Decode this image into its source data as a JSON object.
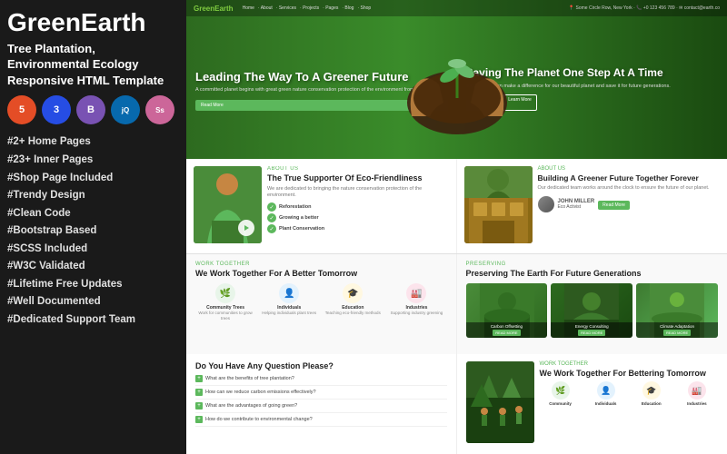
{
  "left": {
    "title": "GreenEarth",
    "subtitle": "Tree Plantation, Environmental Ecology Responsive HTML Template",
    "tech_icons": [
      {
        "label": "HTML5",
        "class": "tech-html",
        "text": "5"
      },
      {
        "label": "CSS3",
        "class": "tech-css",
        "text": "3"
      },
      {
        "label": "Bootstrap",
        "class": "tech-bs",
        "text": "B"
      },
      {
        "label": "jQuery",
        "class": "tech-jq",
        "text": "jQ"
      },
      {
        "label": "Sass",
        "class": "tech-sass",
        "text": "Ss"
      }
    ],
    "features": [
      "#2+ Home Pages",
      "#23+ Inner Pages",
      "#Shop Page Included",
      "#Trendy Design",
      "#Clean Code",
      "#Bootstrap Based",
      "#SCSS Included",
      "#W3C Validated",
      "#Lifetime Free Updates",
      "#Well Documented",
      "#Dedicated Support Team"
    ]
  },
  "right": {
    "nav": {
      "logo": "GreenEarth",
      "items": [
        "Home",
        "About Us",
        "Services",
        "Projects",
        "Pages",
        "Blog",
        "Shop"
      ]
    },
    "hero": {
      "left_headline": "Leading The Way To A Greener Future",
      "left_btn": "Read More",
      "right_headline": "Saving The Planet One Step At A Time",
      "right_btn": "Read More",
      "right_btn2": "Learn More"
    },
    "eco_card": {
      "label": "About Us",
      "title": "The True Supporter Of Eco-Friendliness",
      "text": "We are dedicated to bringing the nature conservation protection of the environment.",
      "features": [
        "Reforestation",
        "Growing a better",
        "Plant Conservation"
      ]
    },
    "building_card": {
      "label": "About Us",
      "title": "Building A Greener Future Together Forever",
      "text": "Our dedicated team works around the clock to ensure the future of our planet.",
      "person_name": "JOHN MILLER",
      "person_role": "Eco Activist",
      "btn": "Read More"
    },
    "work_together": {
      "subtitle": "Work Together",
      "title": "We Work Together For A Better Tomorrow",
      "icons": [
        {
          "symbol": "🌿",
          "label": "Community Trees",
          "bg": "#e8f5e9"
        },
        {
          "symbol": "👤",
          "label": "Individuals",
          "bg": "#e3f2fd"
        },
        {
          "symbol": "🎓",
          "label": "Education",
          "bg": "#fff8e1"
        },
        {
          "symbol": "🏭",
          "label": "Industries",
          "bg": "#fce4ec"
        }
      ]
    },
    "preserve": {
      "subtitle": "Preserving",
      "title": "Preserving The Earth For Future Generations",
      "images": [
        {
          "label": "Carbon Offsetting",
          "btn": "READ MORE"
        },
        {
          "label": "Energy Consulting",
          "btn": "READ MORE"
        },
        {
          "label": "Climate Adaptation",
          "btn": "READ MORE"
        }
      ]
    },
    "faq": {
      "title": "Do You Have Any Question Please?",
      "items": [
        "What are the benefits of tree plantation?",
        "How can we reduce carbon emissions effectively?",
        "What are the advantages of going green?",
        "How do we contribute to environmental change?"
      ]
    },
    "forest": {
      "subtitle": "Work Together",
      "title": "We Work Together For Bettering Tomorrow",
      "icons": [
        {
          "symbol": "🌿",
          "label": "Community",
          "bg": "#e8f5e9"
        },
        {
          "symbol": "👤",
          "label": "Individuals",
          "bg": "#e3f2fd"
        },
        {
          "symbol": "🎓",
          "label": "Education",
          "bg": "#fff8e1"
        },
        {
          "symbol": "🏭",
          "label": "Industries",
          "bg": "#fce4ec"
        }
      ]
    }
  }
}
